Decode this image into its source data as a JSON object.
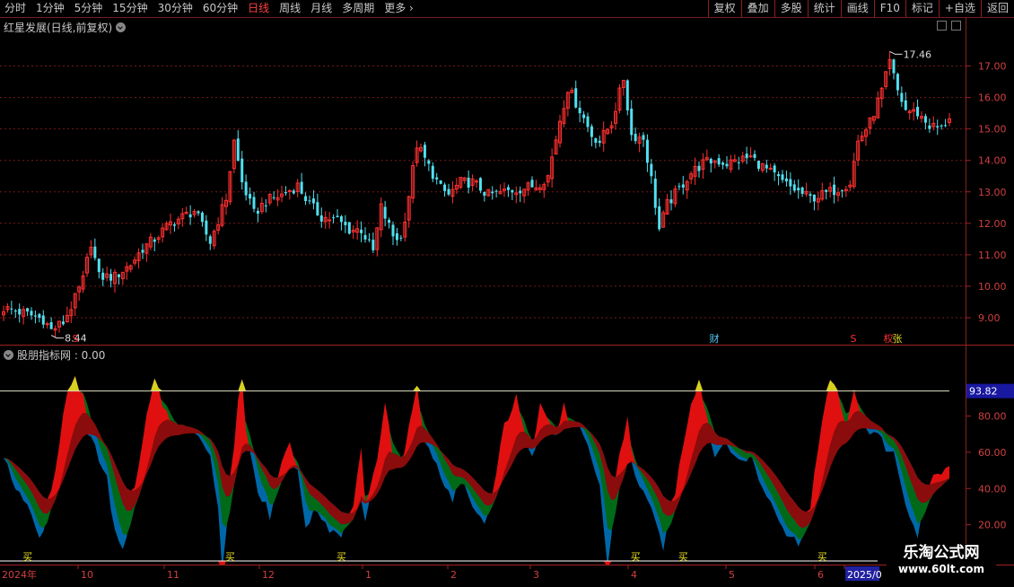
{
  "toolbar": {
    "periods": [
      "分时",
      "1分钟",
      "5分钟",
      "15分钟",
      "30分钟",
      "60分钟",
      "日线",
      "周线",
      "月线",
      "多周期",
      "更多"
    ],
    "active_period": "日线",
    "right_items": [
      "复权",
      "叠加",
      "多股",
      "统计",
      "画线",
      "F10",
      "标记",
      "+自选",
      "返回"
    ]
  },
  "price_pane": {
    "title": "红星发展(日线,前复权)",
    "high_label": "17.46",
    "low_label": "8.44",
    "axis_ticks": [
      "17.00",
      "16.00",
      "15.00",
      "14.00",
      "13.00",
      "12.00",
      "11.00",
      "10.00",
      "9.00"
    ],
    "markers": [
      "S",
      "财",
      "S",
      "权",
      "张"
    ]
  },
  "indicator_pane": {
    "title": "股朋指标网 : 0.00",
    "level_label": "93.82",
    "axis_ticks": [
      "80.00",
      "60.00",
      "40.00",
      "20.00"
    ],
    "buy_label": "买"
  },
  "time_axis": {
    "labels": [
      "2024年",
      "10",
      "11",
      "12",
      "1",
      "2",
      "3",
      "4",
      "5",
      "6",
      "2025/0"
    ]
  },
  "watermark": {
    "line1": "乐淘公式网",
    "line2": "www.60lt.com"
  },
  "colors": {
    "up": "#ff3030",
    "down": "#50e0f0",
    "peak": "#d8d020",
    "red": "#e01010",
    "darkred": "#8a0c0c",
    "green": "#006a18",
    "blue": "#0068a8"
  },
  "chart_data": {
    "type": "candlestick",
    "ylim": [
      8.2,
      17.9
    ],
    "price_keypoints": [
      [
        0,
        9.3
      ],
      [
        5,
        9.15
      ],
      [
        10,
        8.95
      ],
      [
        12,
        8.6
      ],
      [
        15,
        8.85
      ],
      [
        18,
        9.6
      ],
      [
        20,
        10.2
      ],
      [
        22,
        11.4
      ],
      [
        24,
        10.3
      ],
      [
        28,
        10.3
      ],
      [
        32,
        10.7
      ],
      [
        35,
        11.2
      ],
      [
        38,
        11.5
      ],
      [
        42,
        12.0
      ],
      [
        45,
        12.2
      ],
      [
        48,
        12.4
      ],
      [
        52,
        11.4
      ],
      [
        56,
        12.8
      ],
      [
        58,
        14.6
      ],
      [
        60,
        13.3
      ],
      [
        63,
        12.3
      ],
      [
        66,
        12.7
      ],
      [
        70,
        12.9
      ],
      [
        74,
        13.2
      ],
      [
        77,
        12.6
      ],
      [
        80,
        12.2
      ],
      [
        84,
        12.1
      ],
      [
        87,
        11.8
      ],
      [
        90,
        11.8
      ],
      [
        93,
        11.1
      ],
      [
        95,
        12.5
      ],
      [
        98,
        11.6
      ],
      [
        100,
        11.5
      ],
      [
        102,
        12.9
      ],
      [
        104,
        14.5
      ],
      [
        107,
        13.8
      ],
      [
        110,
        13.1
      ],
      [
        112,
        12.9
      ],
      [
        115,
        13.3
      ],
      [
        118,
        13.3
      ],
      [
        122,
        12.9
      ],
      [
        126,
        13.0
      ],
      [
        130,
        13.1
      ],
      [
        134,
        13.2
      ],
      [
        137,
        13.5
      ],
      [
        140,
        15.3
      ],
      [
        142,
        16.3
      ],
      [
        145,
        15.6
      ],
      [
        148,
        14.8
      ],
      [
        150,
        14.6
      ],
      [
        153,
        15.2
      ],
      [
        156,
        16.6
      ],
      [
        158,
        14.8
      ],
      [
        161,
        14.7
      ],
      [
        163,
        13.4
      ],
      [
        165,
        11.8
      ],
      [
        167,
        12.6
      ],
      [
        170,
        13.1
      ],
      [
        173,
        13.6
      ],
      [
        176,
        13.9
      ],
      [
        179,
        14.0
      ],
      [
        182,
        13.9
      ],
      [
        185,
        14.0
      ],
      [
        188,
        14.1
      ],
      [
        192,
        13.7
      ],
      [
        196,
        13.3
      ],
      [
        200,
        13.0
      ],
      [
        203,
        12.8
      ],
      [
        206,
        12.9
      ],
      [
        210,
        13.1
      ],
      [
        213,
        13.3
      ],
      [
        215,
        14.6
      ],
      [
        218,
        15.2
      ],
      [
        221,
        16.2
      ],
      [
        223,
        17.1
      ],
      [
        225,
        16.2
      ],
      [
        227,
        15.6
      ],
      [
        230,
        15.5
      ],
      [
        233,
        15.1
      ],
      [
        236,
        15.0
      ],
      [
        238,
        15.4
      ]
    ],
    "indicator_ylim": [
      0,
      108
    ],
    "indicator_level": 93.82,
    "indicator_level_low": 0,
    "indicator_keypoints": [
      [
        0,
        55
      ],
      [
        3,
        42
      ],
      [
        6,
        30
      ],
      [
        9,
        12
      ],
      [
        11,
        25
      ],
      [
        14,
        65
      ],
      [
        16,
        92
      ],
      [
        18,
        100
      ],
      [
        20,
        90
      ],
      [
        22,
        70
      ],
      [
        26,
        45
      ],
      [
        28,
        15
      ],
      [
        30,
        5
      ],
      [
        33,
        38
      ],
      [
        36,
        80
      ],
      [
        38,
        98
      ],
      [
        40,
        88
      ],
      [
        42,
        74
      ],
      [
        45,
        72
      ],
      [
        48,
        70
      ],
      [
        52,
        60
      ],
      [
        54,
        30
      ],
      [
        55,
        -8
      ],
      [
        57,
        40
      ],
      [
        59,
        92
      ],
      [
        60,
        100
      ],
      [
        61,
        72
      ],
      [
        64,
        40
      ],
      [
        67,
        25
      ],
      [
        70,
        55
      ],
      [
        72,
        68
      ],
      [
        74,
        48
      ],
      [
        76,
        20
      ],
      [
        79,
        28
      ],
      [
        82,
        18
      ],
      [
        85,
        15
      ],
      [
        88,
        30
      ],
      [
        90,
        60
      ],
      [
        91,
        24
      ],
      [
        94,
        58
      ],
      [
        96,
        88
      ],
      [
        98,
        58
      ],
      [
        100,
        50
      ],
      [
        102,
        75
      ],
      [
        104,
        98
      ],
      [
        106,
        65
      ],
      [
        108,
        58
      ],
      [
        111,
        40
      ],
      [
        113,
        35
      ],
      [
        115,
        45
      ],
      [
        118,
        28
      ],
      [
        121,
        20
      ],
      [
        123,
        35
      ],
      [
        126,
        75
      ],
      [
        129,
        90
      ],
      [
        131,
        70
      ],
      [
        133,
        60
      ],
      [
        135,
        90
      ],
      [
        137,
        78
      ],
      [
        139,
        70
      ],
      [
        141,
        85
      ],
      [
        143,
        75
      ],
      [
        145,
        72
      ],
      [
        147,
        62
      ],
      [
        150,
        42
      ],
      [
        152,
        -5
      ],
      [
        155,
        60
      ],
      [
        157,
        78
      ],
      [
        159,
        45
      ],
      [
        161,
        40
      ],
      [
        164,
        20
      ],
      [
        166,
        8
      ],
      [
        168,
        25
      ],
      [
        171,
        65
      ],
      [
        173,
        88
      ],
      [
        175,
        100
      ],
      [
        177,
        80
      ],
      [
        179,
        60
      ],
      [
        182,
        65
      ],
      [
        185,
        55
      ],
      [
        188,
        58
      ],
      [
        191,
        40
      ],
      [
        194,
        30
      ],
      [
        197,
        15
      ],
      [
        200,
        10
      ],
      [
        203,
        28
      ],
      [
        206,
        80
      ],
      [
        208,
        98
      ],
      [
        210,
        92
      ],
      [
        212,
        75
      ],
      [
        214,
        92
      ],
      [
        216,
        80
      ],
      [
        218,
        70
      ],
      [
        220,
        72
      ],
      [
        222,
        62
      ],
      [
        224,
        58
      ],
      [
        226,
        40
      ],
      [
        228,
        22
      ],
      [
        230,
        15
      ],
      [
        232,
        30
      ],
      [
        234,
        50
      ]
    ]
  }
}
